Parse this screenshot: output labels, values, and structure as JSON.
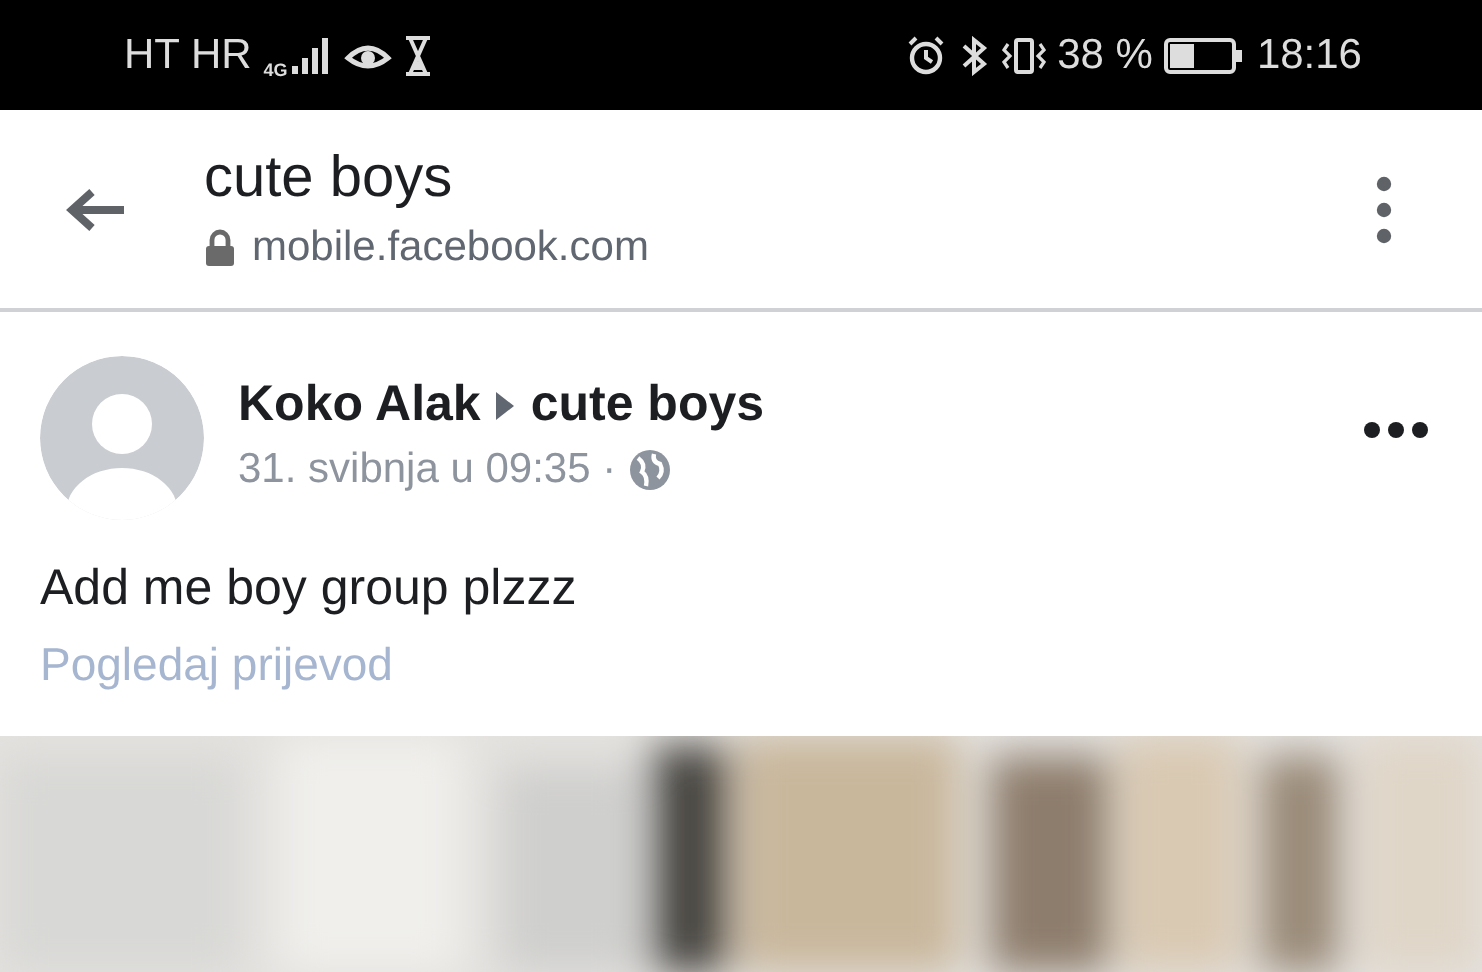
{
  "status_bar": {
    "carrier": "HT HR",
    "network": "4G",
    "battery": "38 %",
    "time": "18:16"
  },
  "address_bar": {
    "title": "cute boys",
    "url": "mobile.facebook.com"
  },
  "post": {
    "author": "Koko Alak",
    "group": "cute boys",
    "date": "31. svibnja u 09:35 ·",
    "text": "Add me boy group plzzz",
    "translate": "Pogledaj prijevod"
  }
}
